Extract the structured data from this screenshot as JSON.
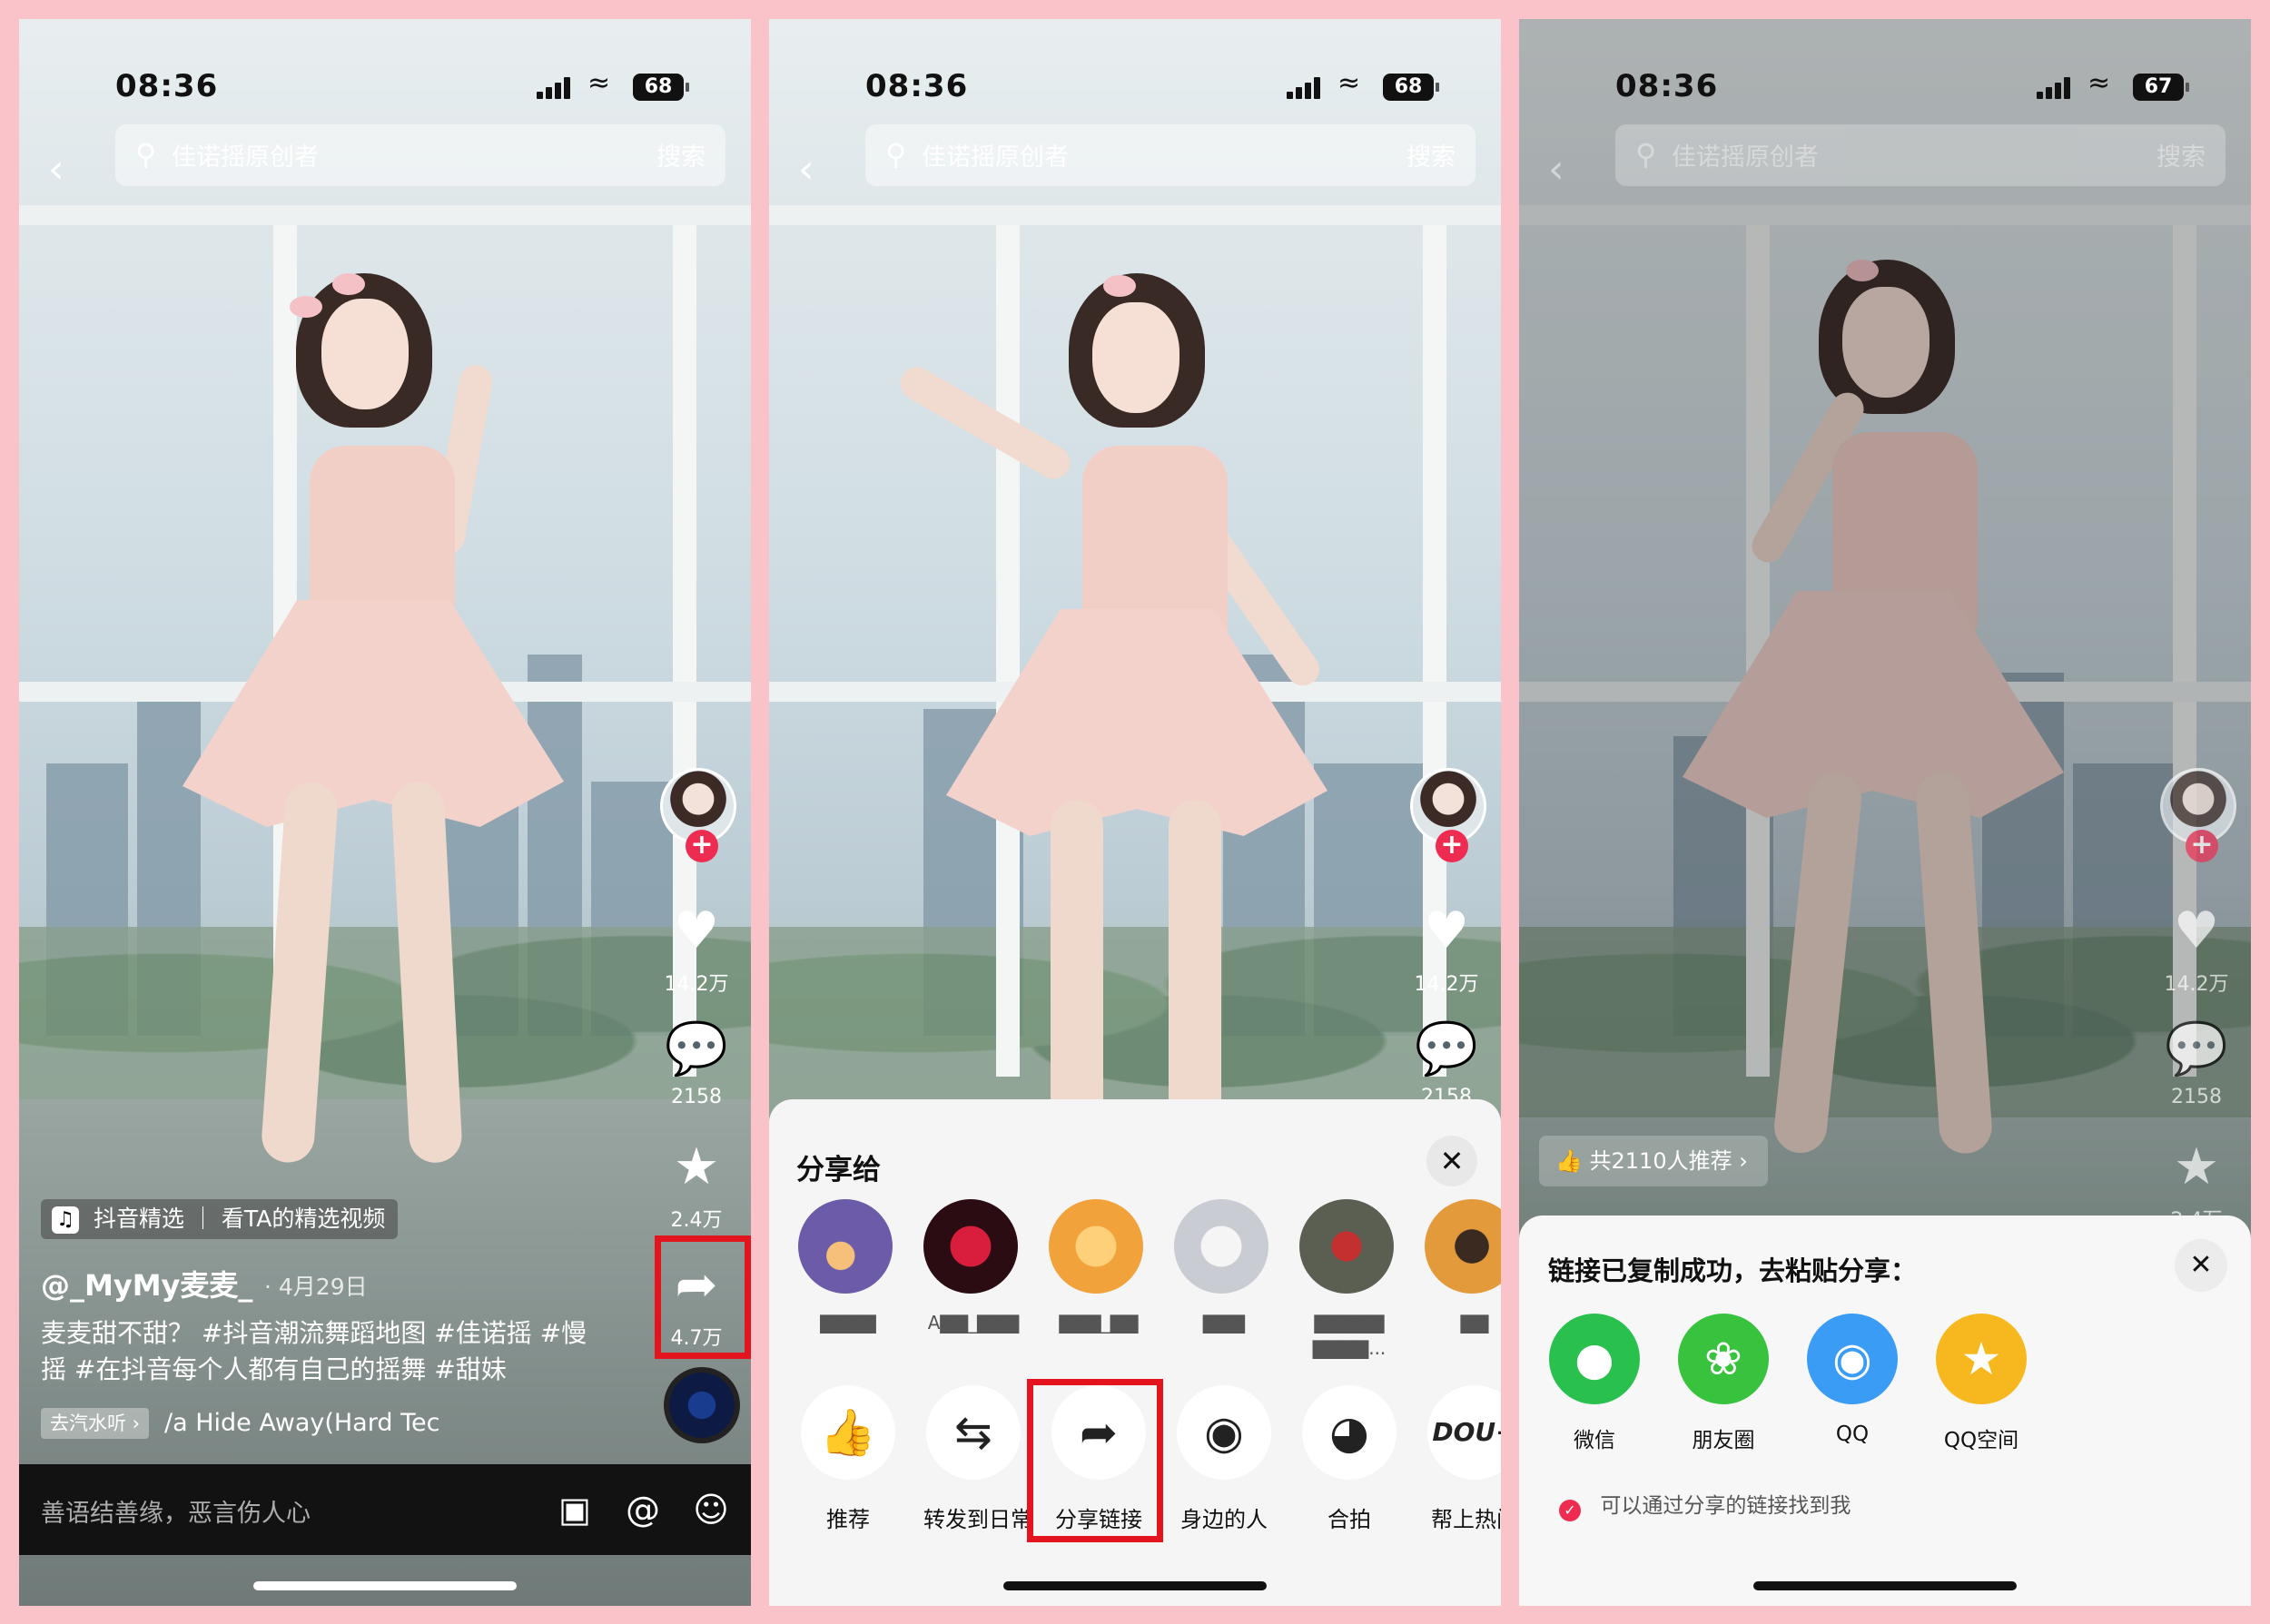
{
  "status": {
    "time": "08:36",
    "battery_1": "68",
    "battery_2": "68",
    "battery_3": "67"
  },
  "search": {
    "query": "佳诺摇原创者",
    "button": "搜索"
  },
  "rail": {
    "likes": "14.2万",
    "comments": "2158",
    "favorites": "2.4万",
    "shares": "4.7万"
  },
  "video": {
    "collection_tag": "抖音精选 ｜ 看TA的精选视频",
    "author": "@_MyMy麦麦_",
    "date": "· 4月29日",
    "description": "麦麦甜不甜？ #抖音潮流舞蹈地图 #佳诺摇 #慢摇 #在抖音每个人都有自己的摇舞 #甜妹",
    "music_tag": "去汽水听 ›",
    "music": "/a   Hide Away(Hard Tec"
  },
  "comment_bar": {
    "placeholder": "善语结善缘，恶言伤人心"
  },
  "share_sheet": {
    "title": "分享给",
    "friends": [
      {
        "name": "▇▇▇▇",
        "color": "#6b5ba8"
      },
      {
        "name": "A▇▇_▇▇▇",
        "color": "#b3122a"
      },
      {
        "name": "▇▇▇_▇▇",
        "color": "#f2a23a"
      },
      {
        "name": "▇▇▇",
        "color": "#c9ccd2"
      },
      {
        "name": "▇▇▇▇▇ ▇▇▇▇...",
        "color": "#5a5f52"
      },
      {
        "name": "▇▇",
        "color": "#e39a3b"
      }
    ],
    "actions": [
      "推荐",
      "转发到日常",
      "分享链接",
      "身边的人",
      "合拍",
      "帮上热门"
    ]
  },
  "copy_panel": {
    "title": "链接已复制成功，去粘贴分享：",
    "apps": [
      {
        "label": "微信",
        "color": "#29c04e"
      },
      {
        "label": "朋友圈",
        "color": "#38c23e"
      },
      {
        "label": "QQ",
        "color": "#3a9cf5"
      },
      {
        "label": "QQ空间",
        "color": "#f6b81e"
      }
    ],
    "hint": "可以通过分享的链接找到我",
    "recommend": "共2110人推荐 ›"
  }
}
